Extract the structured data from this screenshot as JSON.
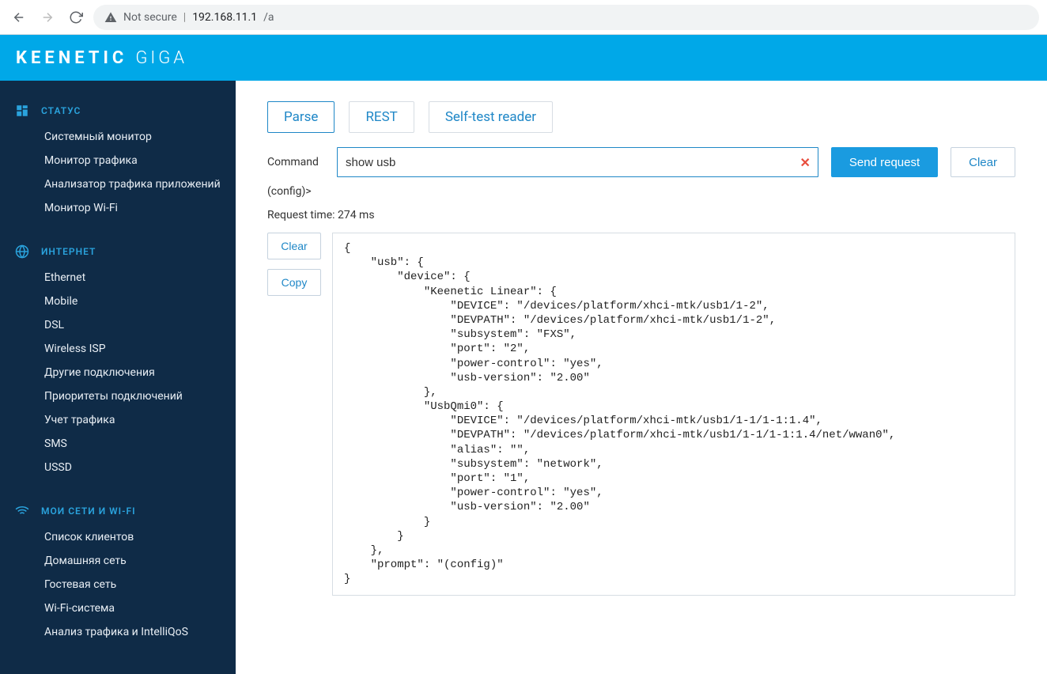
{
  "browser": {
    "secure_label": "Not secure",
    "url_host": "192.168.11.1",
    "url_path": "/a"
  },
  "brand": {
    "name": "KEENETIC",
    "sub": "GIGA"
  },
  "sidebar": {
    "sections": [
      {
        "icon": "dashboard",
        "title": "СТАТУС",
        "items": [
          "Системный монитор",
          "Монитор трафика",
          "Анализатор трафика приложений",
          "Монитор Wi-Fi"
        ]
      },
      {
        "icon": "globe",
        "title": "ИНТЕРНЕТ",
        "items": [
          "Ethernet",
          "Mobile",
          "DSL",
          "Wireless ISP",
          "Другие подключения",
          "Приоритеты подключений",
          "Учет трафика",
          "SMS",
          "USSD"
        ]
      },
      {
        "icon": "wifi",
        "title": "МОИ СЕТИ И WI-FI",
        "items": [
          "Список клиентов",
          "Домашняя сеть",
          "Гостевая сеть",
          "Wi-Fi-система",
          "Анализ трафика и IntelliQoS"
        ]
      }
    ]
  },
  "tabs": {
    "items": [
      "Parse",
      "REST",
      "Self-test reader"
    ],
    "active": 0
  },
  "command": {
    "label": "Command",
    "value": "show usb"
  },
  "buttons": {
    "send": "Send request",
    "clear": "Clear",
    "copy": "Copy"
  },
  "prompt": "(config)>",
  "request_time_label": "Request time: 274 ms",
  "output_text": "{\n    \"usb\": {\n        \"device\": {\n            \"Keenetic Linear\": {\n                \"DEVICE\": \"/devices/platform/xhci-mtk/usb1/1-2\",\n                \"DEVPATH\": \"/devices/platform/xhci-mtk/usb1/1-2\",\n                \"subsystem\": \"FXS\",\n                \"port\": \"2\",\n                \"power-control\": \"yes\",\n                \"usb-version\": \"2.00\"\n            },\n            \"UsbQmi0\": {\n                \"DEVICE\": \"/devices/platform/xhci-mtk/usb1/1-1/1-1:1.4\",\n                \"DEVPATH\": \"/devices/platform/xhci-mtk/usb1/1-1/1-1:1.4/net/wwan0\",\n                \"alias\": \"\",\n                \"subsystem\": \"network\",\n                \"port\": \"1\",\n                \"power-control\": \"yes\",\n                \"usb-version\": \"2.00\"\n            }\n        }\n    },\n    \"prompt\": \"(config)\"\n}"
}
